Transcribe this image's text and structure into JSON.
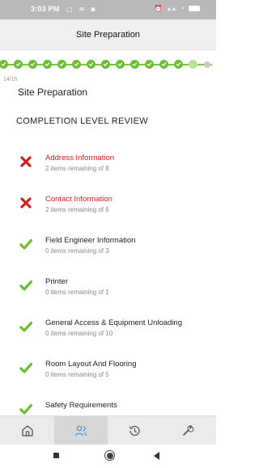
{
  "status_bar": {
    "time": "3:03 PM"
  },
  "header": {
    "title": "Site Preparation"
  },
  "progress": {
    "completed_steps": 13,
    "current_step": 14,
    "total_steps": 15
  },
  "step_counter": "14/15",
  "section_title": "Site Preparation",
  "review_heading": "COMPLETION LEVEL REVIEW",
  "items": [
    {
      "name": "Address Information",
      "sub": "2 items remaining of 8",
      "status": "incomplete"
    },
    {
      "name": "Contact Information",
      "sub": "2 items remaining of 6",
      "status": "incomplete"
    },
    {
      "name": "Field Engineer Information",
      "sub": "0 items remaining of 3",
      "status": "complete"
    },
    {
      "name": "Printer",
      "sub": "0 items remaining of 1",
      "status": "complete"
    },
    {
      "name": "General Access & Equipment Unloading",
      "sub": "0 items remaining of 10",
      "status": "complete"
    },
    {
      "name": "Room Layout And Flooring",
      "sub": "0 items remaining of 5",
      "status": "complete"
    },
    {
      "name": "Safety Requirements",
      "sub": "",
      "status": "complete"
    }
  ],
  "bottom_nav": [
    {
      "icon": "home-icon",
      "active": false
    },
    {
      "icon": "users-icon",
      "active": true
    },
    {
      "icon": "history-icon",
      "active": false
    },
    {
      "icon": "wrench-icon",
      "active": false
    }
  ],
  "colors": {
    "complete": "#6cbf33",
    "incomplete": "#d02020",
    "accent": "#4a90d9"
  }
}
